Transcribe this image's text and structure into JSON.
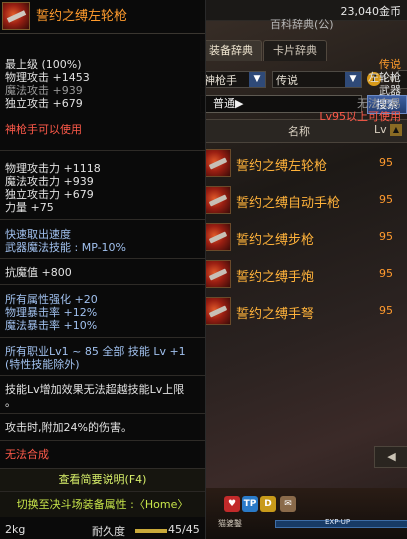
{
  "bg": {
    "gold": "23,040金币",
    "dict_title": "百科辞典(公)",
    "tabs": [
      "装备辞典",
      "卡片辞典"
    ],
    "filter_class": "神枪手",
    "filter_grade": "传说",
    "lv_label": "Lv",
    "search_value": "普通▶",
    "search_button": "搜索",
    "header_name": "名称",
    "header_lv": "Lv",
    "items": [
      {
        "name": "誓约之缚左轮枪",
        "lv": "95"
      },
      {
        "name": "誓约之缚自动手枪",
        "lv": "95"
      },
      {
        "name": "誓约之缚步枪",
        "lv": "95"
      },
      {
        "name": "誓约之缚手炮",
        "lv": "95"
      },
      {
        "name": "誓约之缚手弩",
        "lv": "95"
      }
    ],
    "scroll_prev": "◀",
    "exp_label": "EXP-UP",
    "name_tag": "猫婆鑿"
  },
  "tooltip": {
    "title": "誓约之缚左轮枪",
    "grade_line_left": "最上级 (100%)",
    "grade_line_right": "传说",
    "phys_atk": "物理攻击 +1453",
    "type_right": "左轮枪",
    "mag_atk": "魔法攻击 +939",
    "category_right": "武器",
    "ind_atk": "独立攻击 +679",
    "trade_right": "无法交易",
    "lv_req": "Lv95以上可使用",
    "class_req": "神枪手可以使用",
    "stat1": "物理攻击力 +1118",
    "stat2": "魔法攻击力 +939",
    "stat3": "独立攻击力 +679",
    "stat4": "力量 +75",
    "speed": "快速取出速度",
    "skill_mp": "武器魔法技能 : MP-10%",
    "anti_demon": "抗魔值 +800",
    "elem": "所有属性强化 +20",
    "phys_crit": "物理暴击率 +12%",
    "mag_crit": "魔法暴击率 +10%",
    "skill_lv1": "所有职业Lv1 ~ 85 全部 技能 Lv +1",
    "skill_lv2": "(特性技能除外)",
    "skill_desc1": "技能Lv增加效果无法超越技能Lv上限",
    "skill_desc2": "。",
    "attack_dmg": "攻击时,附加24%的伤害。",
    "no_synth": "无法合成",
    "view_desc": "查看简要说明(F4)",
    "switch": "切换至决斗场装备属性 :〈Home〉",
    "weight": "2kg",
    "durability_label": "耐久度",
    "durability": "45/45",
    "durability_fraction": 1.0
  }
}
